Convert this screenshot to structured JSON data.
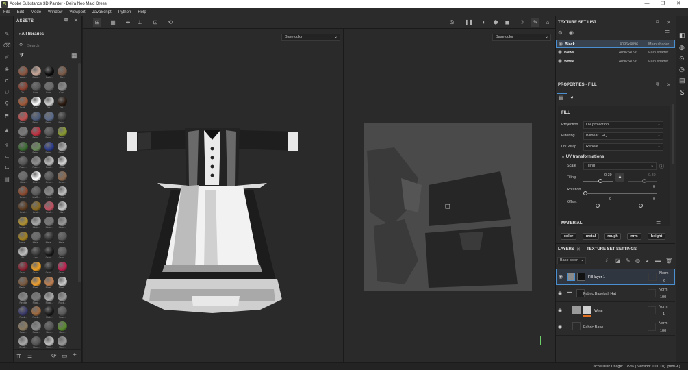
{
  "window": {
    "title": "Adobe Substance 3D Painter - Deira Neo Maid Dress",
    "logo": "Pt"
  },
  "menu": [
    "File",
    "Edit",
    "Mode",
    "Window",
    "Viewport",
    "JavaScript",
    "Python",
    "Help"
  ],
  "assets": {
    "title": "ASSETS",
    "library": "All libraries",
    "search_placeholder": "Search",
    "items": [
      {
        "label": "Autu...",
        "color": "#8a5540"
      },
      {
        "label": "Bake...",
        "color": "#c9a898"
      },
      {
        "label": "Carb...",
        "color": "#0c0c0c"
      },
      {
        "label": "Clo...",
        "color": "#7a5a48"
      },
      {
        "label": "Clo...",
        "color": "#8a4030"
      },
      {
        "label": "Com...",
        "color": "#5a5a5a"
      },
      {
        "label": "Com...",
        "color": "#6a6a6a"
      },
      {
        "label": "Con...",
        "color": "#8a8a8a"
      },
      {
        "label": "Craft...",
        "color": "#a05a3a"
      },
      {
        "label": "Cub...",
        "color": "#ffffff"
      },
      {
        "label": "Dirt...",
        "color": "#d0d0d0"
      },
      {
        "label": "Dirt...",
        "color": "#2a1a10"
      },
      {
        "label": "Fabri...",
        "color": "#c05050"
      },
      {
        "label": "Fabri...",
        "color": "#4a5a7a"
      },
      {
        "label": "Fabri...",
        "color": "#5a6a8a"
      },
      {
        "label": "Fabri...",
        "color": "#3a3a3a"
      },
      {
        "label": "Fabri...",
        "color": "#7a7a7a"
      },
      {
        "label": "Fabri...",
        "color": "#c03040"
      },
      {
        "label": "Fabri...",
        "color": "#555"
      },
      {
        "label": "Fabri...",
        "color": "#8a9a30"
      },
      {
        "label": "Fabri...",
        "color": "#3a6a30"
      },
      {
        "label": "Fabri...",
        "color": "#6a8a5a"
      },
      {
        "label": "Fabri...",
        "color": "#2a3a8a"
      },
      {
        "label": "Fabri...",
        "color": "#b0b0b0"
      },
      {
        "label": "Fabri...",
        "color": "#555"
      },
      {
        "label": "Fabri...",
        "color": "#909090"
      },
      {
        "label": "Foot...",
        "color": "#bbbbbb"
      },
      {
        "label": "Glitter",
        "color": "#d8d8d8"
      },
      {
        "label": "Glos...",
        "color": "#6a6a6a"
      },
      {
        "label": "Grun...",
        "color": "#ffffff"
      },
      {
        "label": "Grou...",
        "color": "#555"
      },
      {
        "label": "Grou...",
        "color": "#8a6a50"
      },
      {
        "label": "Grou...",
        "color": "#8a4a30"
      },
      {
        "label": "Iris B...",
        "color": "#5a5a5a"
      },
      {
        "label": "Iron...",
        "color": "#8a8a8a"
      },
      {
        "label": "Iron...",
        "color": "#c0c0c0"
      },
      {
        "label": "Leat...",
        "color": "#5a3a20"
      },
      {
        "label": "Leat...",
        "color": "#8a6a20"
      },
      {
        "label": "Leat...",
        "color": "#c05060"
      },
      {
        "label": "Mar...",
        "color": "#c8c8c8"
      },
      {
        "label": "Metal...",
        "color": "#b09030"
      },
      {
        "label": "Meta...",
        "color": "#aaaaaa"
      },
      {
        "label": "Meta...",
        "color": "#777"
      },
      {
        "label": "Meta...",
        "color": "#999"
      },
      {
        "label": "Metal...",
        "color": "#a08020"
      },
      {
        "label": "Meta...",
        "color": "#6a6a6a"
      },
      {
        "label": "Meta...",
        "color": "#333"
      },
      {
        "label": "Meta...",
        "color": "#5a5a5a"
      },
      {
        "label": "Mid...",
        "color": "#c0c0c0"
      },
      {
        "label": "Ano...",
        "color": "#3a3a3a"
      },
      {
        "label": "Oran...",
        "color": "#1a1a1a"
      },
      {
        "label": "Oran...",
        "color": "#5a5a5a"
      },
      {
        "label": "Oran...",
        "color": "#8a2030"
      },
      {
        "label": "Oran...",
        "color": "#f0a020"
      },
      {
        "label": "Oran...",
        "color": "#2a2a2a"
      },
      {
        "label": "Oran...",
        "color": "#c02050"
      },
      {
        "label": "Pavin...",
        "color": "#7a5a40"
      },
      {
        "label": "Plast...",
        "color": "#f0a030"
      },
      {
        "label": "Plast...",
        "color": "#c08050"
      },
      {
        "label": "Plast...",
        "color": "#cccccc"
      },
      {
        "label": "Pebble",
        "color": "#8a8a8a"
      },
      {
        "label": "Plast...",
        "color": "#7a7a7a"
      },
      {
        "label": "Plast...",
        "color": "#aaaaaa"
      },
      {
        "label": "Rock...",
        "color": "#999"
      },
      {
        "label": "Rock...",
        "color": "#3a3a6a"
      },
      {
        "label": "Rock...",
        "color": "#a06a40"
      },
      {
        "label": "Rub...",
        "color": "#1a1a1a"
      },
      {
        "label": "Scar...",
        "color": "#5a5a5a"
      },
      {
        "label": "Sand...",
        "color": "#8a7a60"
      },
      {
        "label": "Scrat...",
        "color": "#8a8a8a"
      },
      {
        "label": "Skin...",
        "color": "#555"
      },
      {
        "label": "Skin...",
        "color": "#5a8a30"
      },
      {
        "label": "Small...",
        "color": "#aaaaaa"
      },
      {
        "label": "Stee...",
        "color": "#555"
      },
      {
        "label": "Stee...",
        "color": "#c0c0c0"
      },
      {
        "label": "Stee...",
        "color": "#999"
      }
    ]
  },
  "viewport": {
    "left_channel": "Base color",
    "right_channel": "Base color"
  },
  "texture_sets": {
    "title": "TEXTURE SET LIST",
    "items": [
      {
        "name": "Black",
        "size": "4096x4096",
        "shader": "Main shader"
      },
      {
        "name": "Bows",
        "size": "4096x4096",
        "shader": "Main shader"
      },
      {
        "name": "White",
        "size": "4096x4096",
        "shader": "Main shader"
      }
    ]
  },
  "properties": {
    "title": "PROPERTIES - FILL",
    "section": "FILL",
    "projection_label": "Projection",
    "projection": "UV projection",
    "filtering_label": "Filtering",
    "filtering": "Bilinear | HQ",
    "uvwrap_label": "UV Wrap",
    "uvwrap": "Repeat",
    "uvtrans": "UV transformations",
    "scale_label": "Scale",
    "scale": "Tiling",
    "tiling_label": "Tiling",
    "tiling_value": "0.39",
    "tiling_value2": "0.39",
    "rotation_label": "Rotation",
    "rotation_value": "0",
    "offset_label": "Offset",
    "offset_x": "0",
    "offset_y": "0",
    "material_label": "MATERIAL",
    "channels": [
      "color",
      "metal",
      "rough",
      "nrm",
      "height"
    ]
  },
  "layers": {
    "tab_layers": "LAYERS",
    "tab_tss": "TEXTURE SET SETTINGS",
    "channel": "Base color",
    "items": [
      {
        "name": "Fill layer 1",
        "blend": "Norm",
        "opacity": "6",
        "selected": true
      },
      {
        "name": "Fabric Baseball Hat",
        "blend": "Norm",
        "opacity": "100",
        "folder": true
      },
      {
        "name": "Wear",
        "blend": "Norm",
        "opacity": "1"
      },
      {
        "name": "Fabric Base",
        "blend": "Norm",
        "opacity": "100"
      }
    ]
  },
  "status": {
    "cache": "Cache Disk Usage:",
    "cache_value": "79%",
    "version": "| Version: 10.0.0 (OpenGL)"
  },
  "colors": {
    "accent": "#4a90d0",
    "selected_row": "#3a4a60"
  }
}
